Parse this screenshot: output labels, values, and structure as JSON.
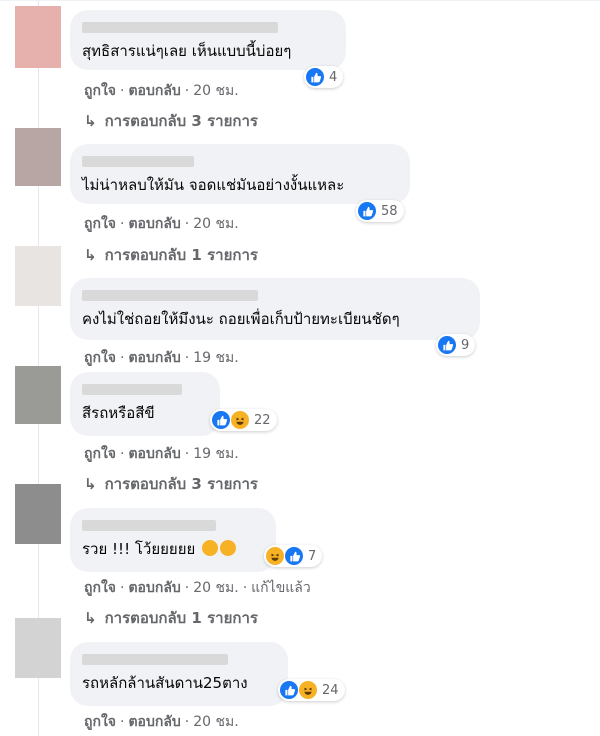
{
  "comments": [
    {
      "text": "สุทธิสารแน่ๆเลย เห็นแบบนี้บ่อยๆ",
      "reactions": {
        "icons": [
          "like-icon"
        ],
        "count": "4"
      },
      "actions": {
        "like": "ถูกใจ",
        "reply": "ตอบกลับ",
        "time": "20 ชม."
      },
      "replies": "การตอบกลับ 3 รายการ"
    },
    {
      "text": "ไม่น่าหลบให้มัน จอดแช่มันอย่างงั้นแหละ",
      "reactions": {
        "icons": [
          "like-icon"
        ],
        "count": "58"
      },
      "actions": {
        "like": "ถูกใจ",
        "reply": "ตอบกลับ",
        "time": "20 ชม."
      },
      "replies": "การตอบกลับ 1 รายการ"
    },
    {
      "text": "คงไม่ใช่ถอยให้มึงนะ ถอยเพื่อเก็บป้ายทะเบียนชัดๆ",
      "reactions": {
        "icons": [
          "like-icon"
        ],
        "count": "9"
      },
      "actions": {
        "like": "ถูกใจ",
        "reply": "ตอบกลับ",
        "time": "19 ชม."
      }
    },
    {
      "text": "สีรถหรือสีขี",
      "reactions": {
        "icons": [
          "like-icon",
          "haha-icon"
        ],
        "count": "22"
      },
      "actions": {
        "like": "ถูกใจ",
        "reply": "ตอบกลับ",
        "time": "19 ชม."
      },
      "replies": "การตอบกลับ 3 รายการ"
    },
    {
      "text": "รวย !!! โว้ยยยยย",
      "reactions": {
        "icons": [
          "haha-icon",
          "like-icon"
        ],
        "count": "7"
      },
      "actions": {
        "like": "ถูกใจ",
        "reply": "ตอบกลับ",
        "time": "20 ชม.",
        "edited": "แก้ไขแล้ว"
      },
      "replies": "การตอบกลับ 1 รายการ"
    },
    {
      "text": "รถหลักล้านสันดาน25ตาง",
      "reactions": {
        "icons": [
          "like-icon",
          "haha-icon"
        ],
        "count": "24"
      },
      "actions": {
        "like": "ถูกใจ",
        "reply": "ตอบกลับ",
        "time": "20 ชม."
      }
    }
  ],
  "separator": "·",
  "colors": {
    "like": "#1877f2",
    "haha": "#f7b125",
    "bubble": "#f0f2f5",
    "meta": "#65676b"
  }
}
